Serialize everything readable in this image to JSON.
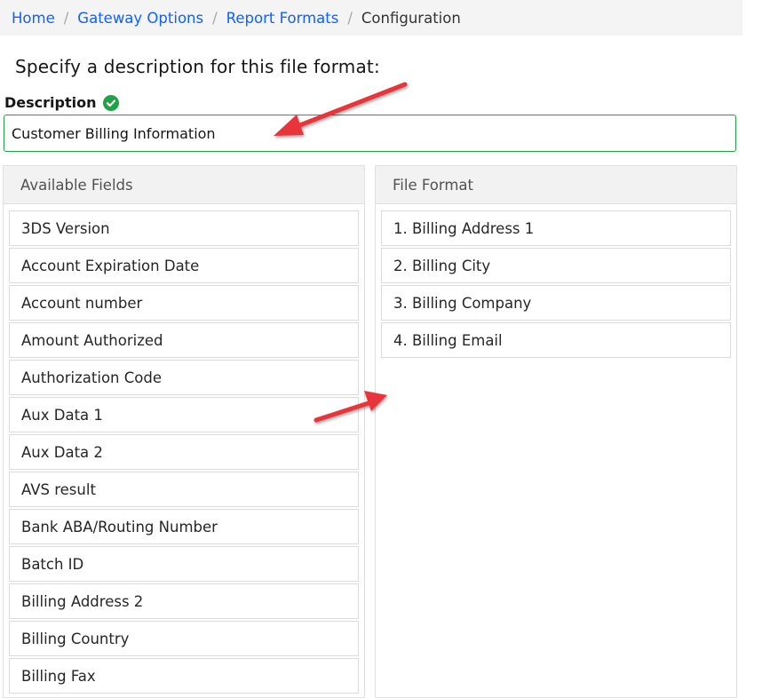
{
  "breadcrumb": {
    "items": [
      {
        "label": "Home"
      },
      {
        "label": "Gateway Options"
      },
      {
        "label": "Report Formats"
      }
    ],
    "separator": "/",
    "current": "Configuration"
  },
  "form": {
    "heading": "Specify a description for this file format:",
    "description_label": "Description",
    "description_value": "Customer Billing Information",
    "valid_icon": "check-circle-icon",
    "valid_color": "#24a148"
  },
  "available_fields": {
    "title": "Available Fields",
    "items": [
      "3DS Version",
      "Account Expiration Date",
      "Account number",
      "Amount Authorized",
      "Authorization Code",
      "Aux Data 1",
      "Aux Data 2",
      "AVS result",
      "Bank ABA/Routing Number",
      "Batch ID",
      "Billing Address 2",
      "Billing Country",
      "Billing Fax"
    ]
  },
  "file_format": {
    "title": "File Format",
    "items": [
      "1. Billing Address 1",
      "2. Billing City",
      "3. Billing Company",
      "4. Billing Email"
    ]
  },
  "colors": {
    "link": "#0f62fe",
    "annotation_arrow": "#e8343a"
  }
}
